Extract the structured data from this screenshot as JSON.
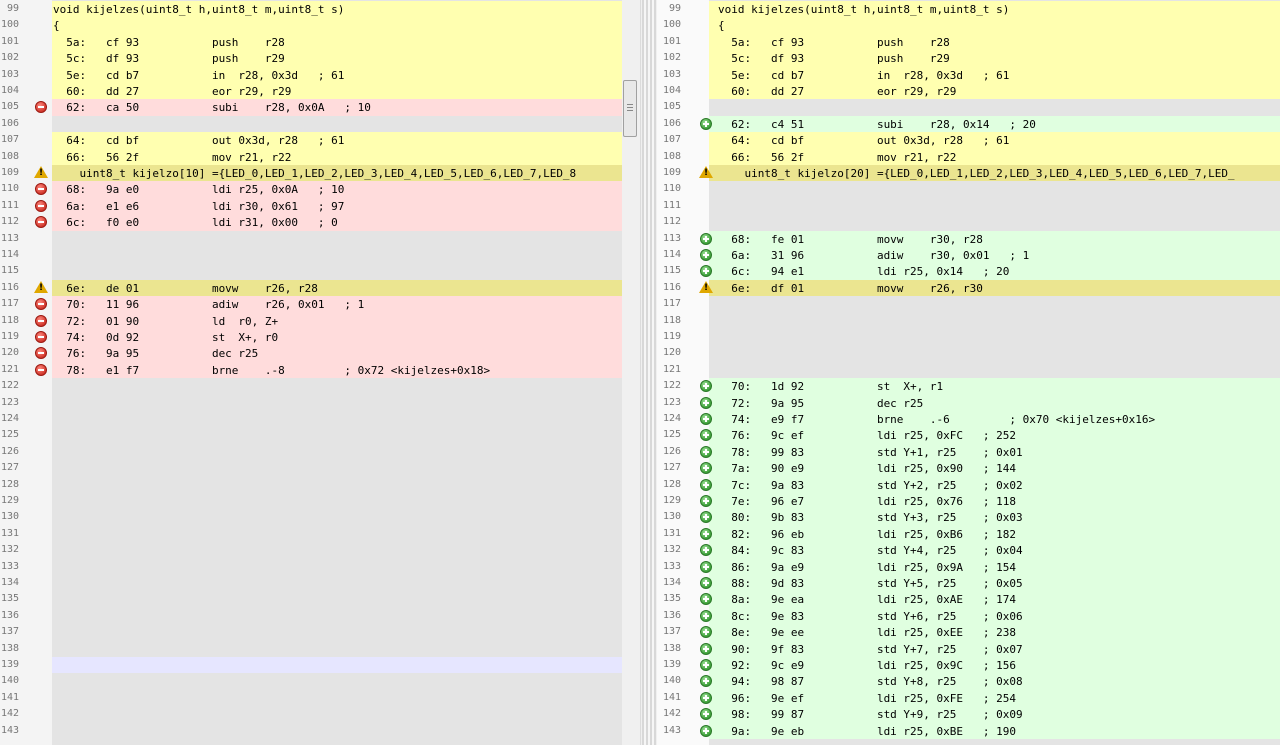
{
  "left": {
    "rows": [
      {
        "ln": "99",
        "k": "y",
        "i": "",
        "t": "void kijelzes(uint8_t h,uint8_t m,uint8_t s)"
      },
      {
        "ln": "100",
        "k": "y",
        "i": "",
        "t": "{"
      },
      {
        "ln": "101",
        "k": "y",
        "i": "",
        "t": "  5a:   cf 93           push    r28"
      },
      {
        "ln": "102",
        "k": "y",
        "i": "",
        "t": "  5c:   df 93           push    r29"
      },
      {
        "ln": "103",
        "k": "y",
        "i": "",
        "t": "  5e:   cd b7           in  r28, 0x3d   ; 61"
      },
      {
        "ln": "104",
        "k": "y",
        "i": "",
        "t": "  60:   dd 27           eor r29, r29"
      },
      {
        "ln": "105",
        "k": "d",
        "i": "del",
        "t": "  62:   ca 50           subi    r28, 0x0A   ; 10"
      },
      {
        "ln": "106",
        "k": "g",
        "i": "",
        "t": ""
      },
      {
        "ln": "107",
        "k": "y",
        "i": "",
        "t": "  64:   cd bf           out 0x3d, r28   ; 61"
      },
      {
        "ln": "108",
        "k": "y",
        "i": "",
        "t": "  66:   56 2f           mov r21, r22"
      },
      {
        "ln": "109",
        "k": "w",
        "i": "warn",
        "t": "    uint8_t kijelzo[10] ={LED_0,LED_1,LED_2,LED_3,LED_4,LED_5,LED_6,LED_7,LED_8"
      },
      {
        "ln": "110",
        "k": "d",
        "i": "del",
        "t": "  68:   9a e0           ldi r25, 0x0A   ; 10"
      },
      {
        "ln": "111",
        "k": "d",
        "i": "del",
        "t": "  6a:   e1 e6           ldi r30, 0x61   ; 97"
      },
      {
        "ln": "112",
        "k": "d",
        "i": "del",
        "t": "  6c:   f0 e0           ldi r31, 0x00   ; 0"
      },
      {
        "ln": "113",
        "k": "g",
        "i": "",
        "t": ""
      },
      {
        "ln": "114",
        "k": "g",
        "i": "",
        "t": ""
      },
      {
        "ln": "115",
        "k": "g",
        "i": "",
        "t": ""
      },
      {
        "ln": "116",
        "k": "w",
        "i": "warn",
        "t": "  6e:   de 01           movw    r26, r28"
      },
      {
        "ln": "117",
        "k": "d",
        "i": "del",
        "t": "  70:   11 96           adiw    r26, 0x01   ; 1"
      },
      {
        "ln": "118",
        "k": "d",
        "i": "del",
        "t": "  72:   01 90           ld  r0, Z+"
      },
      {
        "ln": "119",
        "k": "d",
        "i": "del",
        "t": "  74:   0d 92           st  X+, r0"
      },
      {
        "ln": "120",
        "k": "d",
        "i": "del",
        "t": "  76:   9a 95           dec r25"
      },
      {
        "ln": "121",
        "k": "d",
        "i": "del",
        "t": "  78:   e1 f7           brne    .-8         ; 0x72 <kijelzes+0x18>"
      },
      {
        "ln": "122",
        "k": "g",
        "i": "",
        "t": ""
      },
      {
        "ln": "123",
        "k": "g",
        "i": "",
        "t": ""
      },
      {
        "ln": "124",
        "k": "g",
        "i": "",
        "t": ""
      },
      {
        "ln": "125",
        "k": "g",
        "i": "",
        "t": ""
      },
      {
        "ln": "126",
        "k": "g",
        "i": "",
        "t": ""
      },
      {
        "ln": "127",
        "k": "g",
        "i": "",
        "t": ""
      },
      {
        "ln": "128",
        "k": "g",
        "i": "",
        "t": ""
      },
      {
        "ln": "129",
        "k": "g",
        "i": "",
        "t": ""
      },
      {
        "ln": "130",
        "k": "g",
        "i": "",
        "t": ""
      },
      {
        "ln": "131",
        "k": "g",
        "i": "",
        "t": ""
      },
      {
        "ln": "132",
        "k": "g",
        "i": "",
        "t": ""
      },
      {
        "ln": "133",
        "k": "g",
        "i": "",
        "t": ""
      },
      {
        "ln": "134",
        "k": "g",
        "i": "",
        "t": ""
      },
      {
        "ln": "135",
        "k": "g",
        "i": "",
        "t": ""
      },
      {
        "ln": "136",
        "k": "g",
        "i": "",
        "t": ""
      },
      {
        "ln": "137",
        "k": "g",
        "i": "",
        "t": ""
      },
      {
        "ln": "138",
        "k": "g",
        "i": "",
        "t": ""
      },
      {
        "ln": "139",
        "k": "s",
        "i": "",
        "t": ""
      },
      {
        "ln": "140",
        "k": "g",
        "i": "",
        "t": ""
      },
      {
        "ln": "141",
        "k": "g",
        "i": "",
        "t": ""
      },
      {
        "ln": "142",
        "k": "g",
        "i": "",
        "t": ""
      },
      {
        "ln": "143",
        "k": "g",
        "i": "",
        "t": ""
      }
    ]
  },
  "right": {
    "rows": [
      {
        "ln": "99",
        "k": "y",
        "i": "",
        "t": "void kijelzes(uint8_t h,uint8_t m,uint8_t s)"
      },
      {
        "ln": "100",
        "k": "y",
        "i": "",
        "t": "{"
      },
      {
        "ln": "101",
        "k": "y",
        "i": "",
        "t": "  5a:   cf 93           push    r28"
      },
      {
        "ln": "102",
        "k": "y",
        "i": "",
        "t": "  5c:   df 93           push    r29"
      },
      {
        "ln": "103",
        "k": "y",
        "i": "",
        "t": "  5e:   cd b7           in  r28, 0x3d   ; 61"
      },
      {
        "ln": "104",
        "k": "y",
        "i": "",
        "t": "  60:   dd 27           eor r29, r29"
      },
      {
        "ln": "105",
        "k": "g",
        "i": "",
        "t": ""
      },
      {
        "ln": "106",
        "k": "a",
        "i": "add",
        "t": "  62:   c4 51           subi    r28, 0x14   ; 20"
      },
      {
        "ln": "107",
        "k": "y",
        "i": "",
        "t": "  64:   cd bf           out 0x3d, r28   ; 61"
      },
      {
        "ln": "108",
        "k": "y",
        "i": "",
        "t": "  66:   56 2f           mov r21, r22"
      },
      {
        "ln": "109",
        "k": "w",
        "i": "warn",
        "t": "    uint8_t kijelzo[20] ={LED_0,LED_1,LED_2,LED_3,LED_4,LED_5,LED_6,LED_7,LED_"
      },
      {
        "ln": "110",
        "k": "g",
        "i": "",
        "t": ""
      },
      {
        "ln": "111",
        "k": "g",
        "i": "",
        "t": ""
      },
      {
        "ln": "112",
        "k": "g",
        "i": "",
        "t": ""
      },
      {
        "ln": "113",
        "k": "a",
        "i": "add",
        "t": "  68:   fe 01           movw    r30, r28"
      },
      {
        "ln": "114",
        "k": "a",
        "i": "add",
        "t": "  6a:   31 96           adiw    r30, 0x01   ; 1"
      },
      {
        "ln": "115",
        "k": "a",
        "i": "add",
        "t": "  6c:   94 e1           ldi r25, 0x14   ; 20"
      },
      {
        "ln": "116",
        "k": "w",
        "i": "warn",
        "t": "  6e:   df 01           movw    r26, r30"
      },
      {
        "ln": "117",
        "k": "g",
        "i": "",
        "t": ""
      },
      {
        "ln": "118",
        "k": "g",
        "i": "",
        "t": ""
      },
      {
        "ln": "119",
        "k": "g",
        "i": "",
        "t": ""
      },
      {
        "ln": "120",
        "k": "g",
        "i": "",
        "t": ""
      },
      {
        "ln": "121",
        "k": "g",
        "i": "",
        "t": ""
      },
      {
        "ln": "122",
        "k": "a",
        "i": "add",
        "t": "  70:   1d 92           st  X+, r1"
      },
      {
        "ln": "123",
        "k": "a",
        "i": "add",
        "t": "  72:   9a 95           dec r25"
      },
      {
        "ln": "124",
        "k": "a",
        "i": "add",
        "t": "  74:   e9 f7           brne    .-6         ; 0x70 <kijelzes+0x16>"
      },
      {
        "ln": "125",
        "k": "a",
        "i": "add",
        "t": "  76:   9c ef           ldi r25, 0xFC   ; 252"
      },
      {
        "ln": "126",
        "k": "a",
        "i": "add",
        "t": "  78:   99 83           std Y+1, r25    ; 0x01"
      },
      {
        "ln": "127",
        "k": "a",
        "i": "add",
        "t": "  7a:   90 e9           ldi r25, 0x90   ; 144"
      },
      {
        "ln": "128",
        "k": "a",
        "i": "add",
        "t": "  7c:   9a 83           std Y+2, r25    ; 0x02"
      },
      {
        "ln": "129",
        "k": "a",
        "i": "add",
        "t": "  7e:   96 e7           ldi r25, 0x76   ; 118"
      },
      {
        "ln": "130",
        "k": "a",
        "i": "add",
        "t": "  80:   9b 83           std Y+3, r25    ; 0x03"
      },
      {
        "ln": "131",
        "k": "a",
        "i": "add",
        "t": "  82:   96 eb           ldi r25, 0xB6   ; 182"
      },
      {
        "ln": "132",
        "k": "a",
        "i": "add",
        "t": "  84:   9c 83           std Y+4, r25    ; 0x04"
      },
      {
        "ln": "133",
        "k": "a",
        "i": "add",
        "t": "  86:   9a e9           ldi r25, 0x9A   ; 154"
      },
      {
        "ln": "134",
        "k": "a",
        "i": "add",
        "t": "  88:   9d 83           std Y+5, r25    ; 0x05"
      },
      {
        "ln": "135",
        "k": "a",
        "i": "add",
        "t": "  8a:   9e ea           ldi r25, 0xAE   ; 174"
      },
      {
        "ln": "136",
        "k": "a",
        "i": "add",
        "t": "  8c:   9e 83           std Y+6, r25    ; 0x06"
      },
      {
        "ln": "137",
        "k": "a",
        "i": "add",
        "t": "  8e:   9e ee           ldi r25, 0xEE   ; 238"
      },
      {
        "ln": "138",
        "k": "a",
        "i": "add",
        "t": "  90:   9f 83           std Y+7, r25    ; 0x07"
      },
      {
        "ln": "139",
        "k": "a",
        "i": "add",
        "t": "  92:   9c e9           ldi r25, 0x9C   ; 156"
      },
      {
        "ln": "140",
        "k": "a",
        "i": "add",
        "t": "  94:   98 87           std Y+8, r25    ; 0x08"
      },
      {
        "ln": "141",
        "k": "a",
        "i": "add",
        "t": "  96:   9e ef           ldi r25, 0xFE   ; 254"
      },
      {
        "ln": "142",
        "k": "a",
        "i": "add",
        "t": "  98:   99 87           std Y+9, r25    ; 0x09"
      },
      {
        "ln": "143",
        "k": "a",
        "i": "add",
        "t": "  9a:   9e eb           ldi r25, 0xBE   ; 190"
      }
    ]
  },
  "icons": {
    "del": "minus-circle-icon",
    "add": "plus-circle-icon",
    "warn": "warning-icon"
  },
  "colors": {
    "equal": "#ffffb0",
    "deleted": "#ffdcdc",
    "added": "#e0ffe0",
    "modified": "#ebe590",
    "gap": "#e4e4e4",
    "selected": "#e6e6ff"
  }
}
